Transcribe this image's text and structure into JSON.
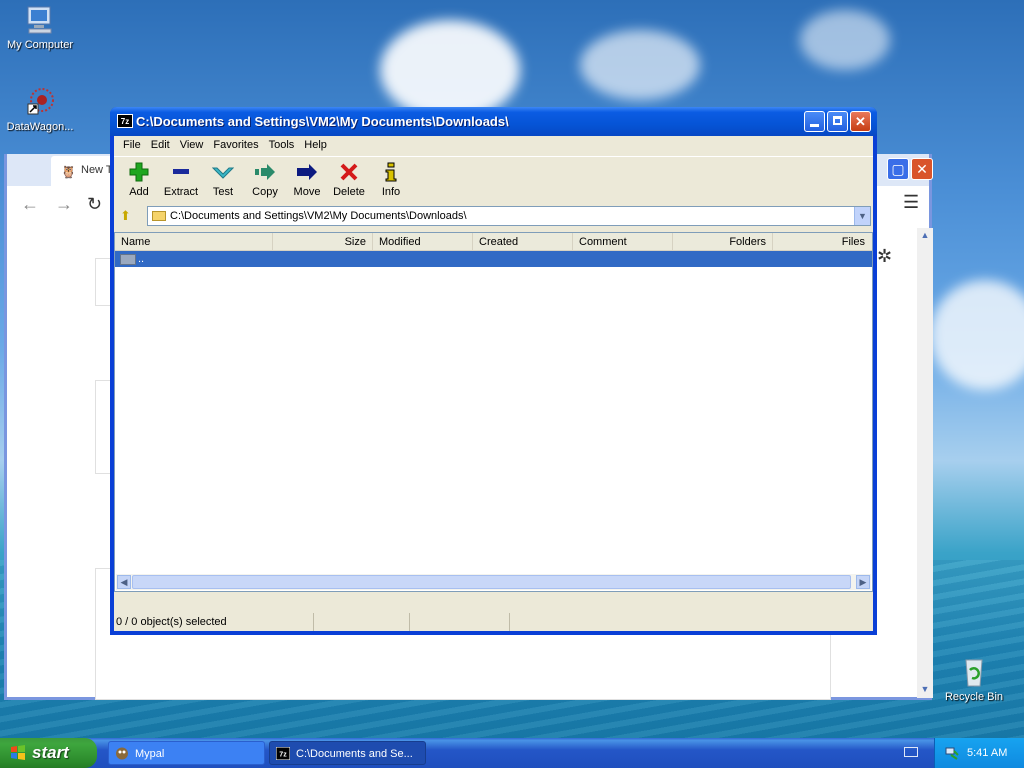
{
  "desktop": {
    "icons": [
      {
        "label": "My Computer",
        "icon": "my-computer-icon"
      },
      {
        "label": "DataWagon...",
        "icon": "datawagon-shortcut-icon"
      },
      {
        "label": "Recycle Bin",
        "icon": "recycle-bin-icon"
      }
    ]
  },
  "browser": {
    "tab_title": "New Ta"
  },
  "zip_window": {
    "title": "C:\\Documents and Settings\\VM2\\My Documents\\Downloads\\",
    "app_icon_text": "7z",
    "menu": [
      "File",
      "Edit",
      "View",
      "Favorites",
      "Tools",
      "Help"
    ],
    "toolbar": [
      {
        "label": "Add",
        "icon": "add-icon",
        "color": "#1fa61f"
      },
      {
        "label": "Extract",
        "icon": "extract-icon",
        "color": "#1a2a9c"
      },
      {
        "label": "Test",
        "icon": "test-check-icon",
        "color": "#3bb8c8"
      },
      {
        "label": "Copy",
        "icon": "copy-arrow-icon",
        "color": "#2a8a6a"
      },
      {
        "label": "Move",
        "icon": "move-arrow-icon",
        "color": "#0c1a80"
      },
      {
        "label": "Delete",
        "icon": "delete-x-icon",
        "color": "#d41a1a"
      },
      {
        "label": "Info",
        "icon": "info-icon",
        "color": "#d9c200"
      }
    ],
    "address": "C:\\Documents and Settings\\VM2\\My Documents\\Downloads\\",
    "columns": [
      "Name",
      "Size",
      "Modified",
      "Created",
      "Comment",
      "Folders",
      "Files"
    ],
    "rows": [
      {
        "name": "..",
        "selected": true
      }
    ],
    "status": "0 / 0 object(s) selected"
  },
  "taskbar": {
    "start_label": "start",
    "tasks": [
      {
        "label": "Mypal",
        "active": false
      },
      {
        "label": "C:\\Documents and Se...",
        "active": true
      }
    ],
    "clock": "5:41 AM"
  },
  "colors": {
    "xp_blue": "#0a3fd6",
    "selection": "#316ac5",
    "start_green": "#3ea63e"
  }
}
